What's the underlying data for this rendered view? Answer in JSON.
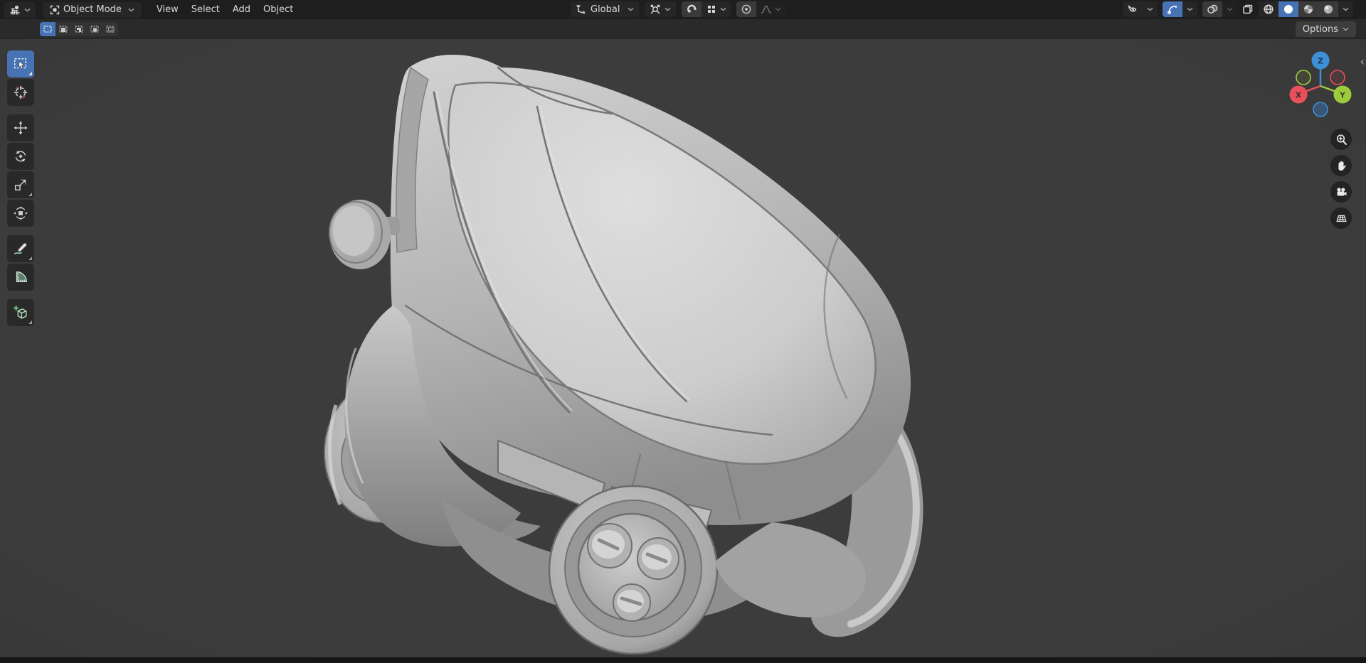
{
  "colors": {
    "accent": "#4772b3",
    "axis-x": "#e8505a",
    "axis-y": "#9ecb3b",
    "axis-z": "#3d8fd6"
  },
  "header": {
    "editor_type_icon": "3d-viewport-editor-icon",
    "mode_dropdown": {
      "label": "Object Mode",
      "icon": "object-mode-icon"
    },
    "menus": [
      {
        "label": "View"
      },
      {
        "label": "Select"
      },
      {
        "label": "Add"
      },
      {
        "label": "Object"
      }
    ],
    "transform_orientation": {
      "label": "Global",
      "icon": "orientation-axes-icon"
    },
    "pivot_point": {
      "icon": "pivot-point-icon"
    },
    "snapping": {
      "toggle_icon": "magnet-icon",
      "target_icon": "snap-increment-dots-icon",
      "enabled": false
    },
    "proportional_editing": {
      "toggle_icon": "proportional-circle-icon",
      "falloff_icon": "falloff-curve-icon",
      "enabled": false
    },
    "visibility": {
      "icon": "show-object-types-icon"
    },
    "gizmos": {
      "icon": "gizmo-arc-icon",
      "enabled": true
    },
    "overlays": {
      "icon": "overlays-circles-icon",
      "enabled": false
    },
    "xray": {
      "icon": "xray-squares-icon",
      "enabled": false
    },
    "shading_modes": [
      {
        "name": "wireframe",
        "icon": "wireframe-sphere-icon",
        "active": false
      },
      {
        "name": "solid",
        "icon": "solid-sphere-icon",
        "active": true
      },
      {
        "name": "material-preview",
        "icon": "material-sphere-icon",
        "active": false
      },
      {
        "name": "rendered",
        "icon": "rendered-sphere-icon",
        "active": false
      }
    ]
  },
  "tool_settings": {
    "select_modes": [
      {
        "name": "set",
        "active": true
      },
      {
        "name": "extend",
        "active": false
      },
      {
        "name": "subtract",
        "active": false
      },
      {
        "name": "invert",
        "active": false
      },
      {
        "name": "intersect",
        "active": false
      }
    ],
    "options_label": "Options"
  },
  "toolbar": {
    "tools": [
      {
        "name": "select-box",
        "active": true,
        "has_subtools": true
      },
      {
        "name": "cursor",
        "active": false,
        "has_subtools": false
      },
      {
        "name": "move",
        "active": false,
        "has_subtools": false
      },
      {
        "name": "rotate",
        "active": false,
        "has_subtools": false
      },
      {
        "name": "scale",
        "active": false,
        "has_subtools": true
      },
      {
        "name": "transform",
        "active": false,
        "has_subtools": false
      },
      {
        "name": "annotate",
        "active": false,
        "has_subtools": true
      },
      {
        "name": "measure",
        "active": false,
        "has_subtools": false
      },
      {
        "name": "add-cube",
        "active": false,
        "has_subtools": true
      }
    ]
  },
  "viewport": {
    "gizmo_axis_labels": {
      "x": "X",
      "y": "Y",
      "z": "Z"
    },
    "nav_buttons": [
      {
        "name": "zoom"
      },
      {
        "name": "pan"
      },
      {
        "name": "camera-view"
      },
      {
        "name": "toggle-orthographic"
      }
    ],
    "model": "stylized-car",
    "shading": "solid-matcap-gray"
  }
}
